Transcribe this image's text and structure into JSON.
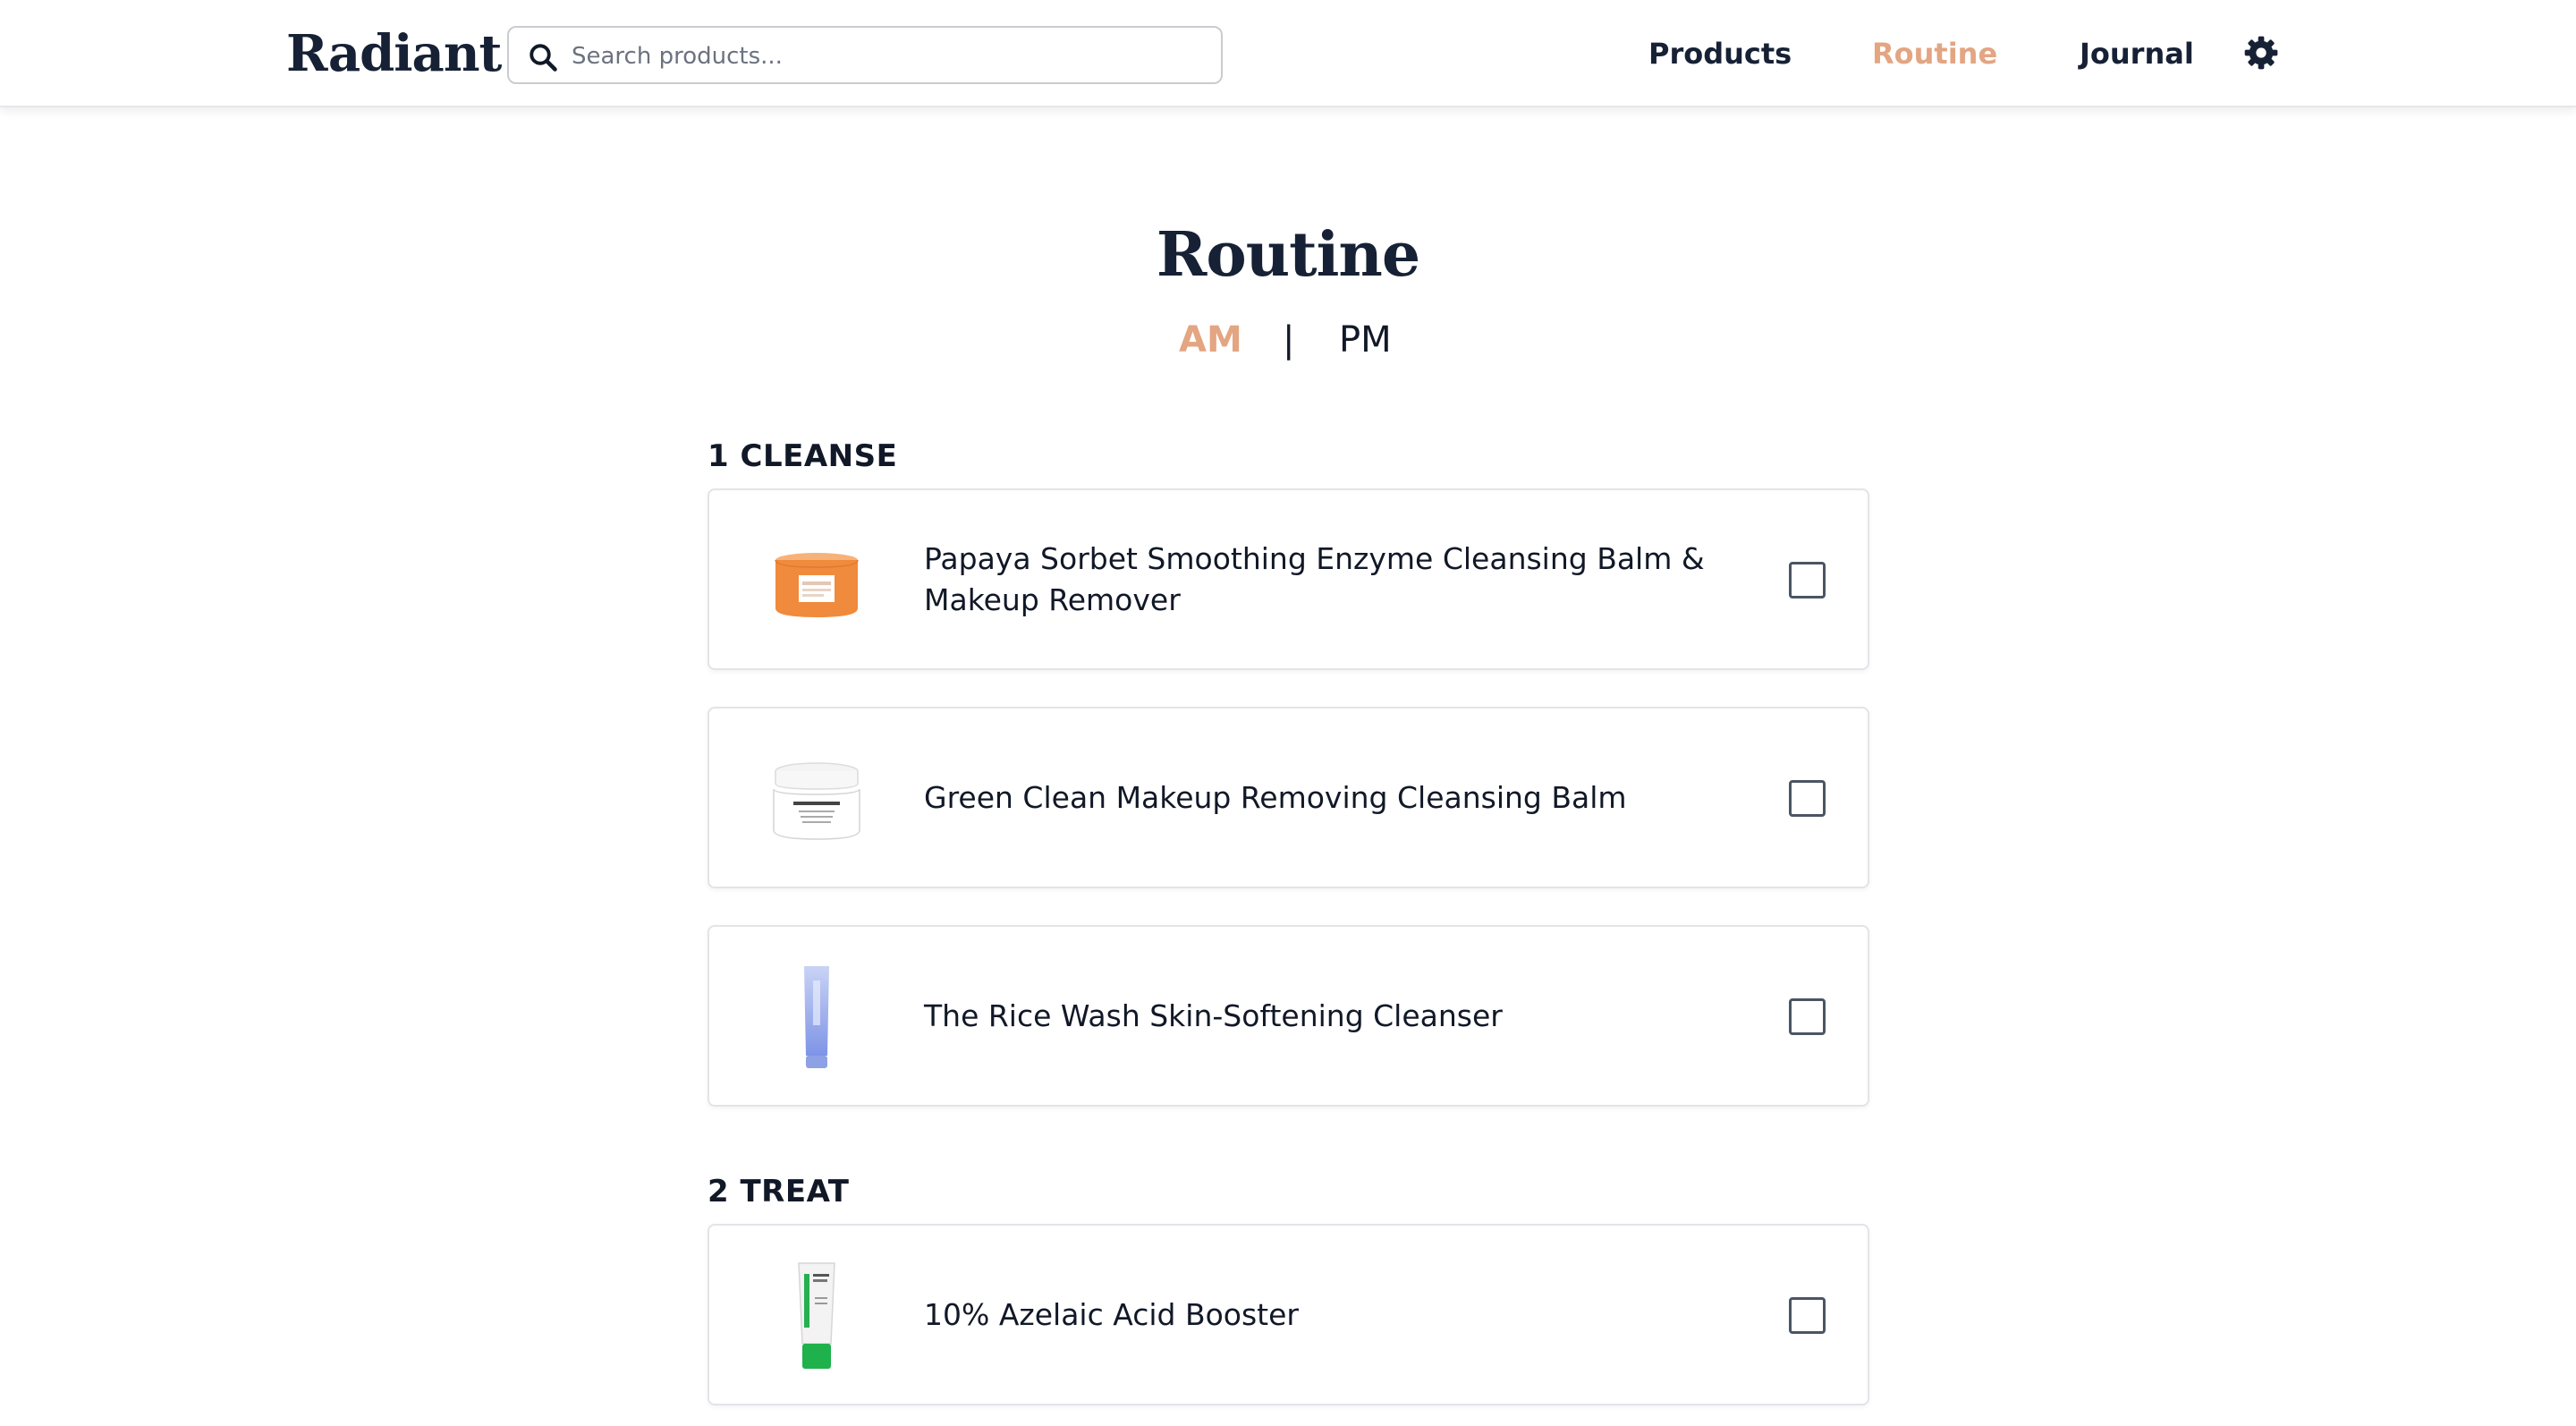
{
  "header": {
    "logo": "Radiant",
    "search": {
      "placeholder": "Search products...",
      "value": ""
    },
    "nav": [
      {
        "label": "Products",
        "active": false
      },
      {
        "label": "Routine",
        "active": true
      },
      {
        "label": "Journal",
        "active": false
      }
    ],
    "settings_icon": "gear-icon",
    "accent_color": "#e3a582",
    "brand_color": "#172135"
  },
  "page": {
    "title": "Routine",
    "toggle": {
      "am": "AM",
      "separator": "|",
      "pm": "PM",
      "selected": "AM"
    }
  },
  "sections": [
    {
      "title": "1 CLEANSE",
      "items": [
        {
          "name": "Papaya Sorbet Smoothing Enzyme Cleansing Balm & Makeup Remover",
          "image": "orange-jar",
          "checked": false
        },
        {
          "name": "Green Clean Makeup Removing Cleansing Balm",
          "image": "white-jar",
          "checked": false
        },
        {
          "name": "The Rice Wash Skin-Softening Cleanser",
          "image": "blue-tube",
          "checked": false
        }
      ]
    },
    {
      "title": "2 TREAT",
      "items": [
        {
          "name": "10% Azelaic Acid Booster",
          "image": "white-green-tube",
          "checked": false
        }
      ]
    }
  ]
}
